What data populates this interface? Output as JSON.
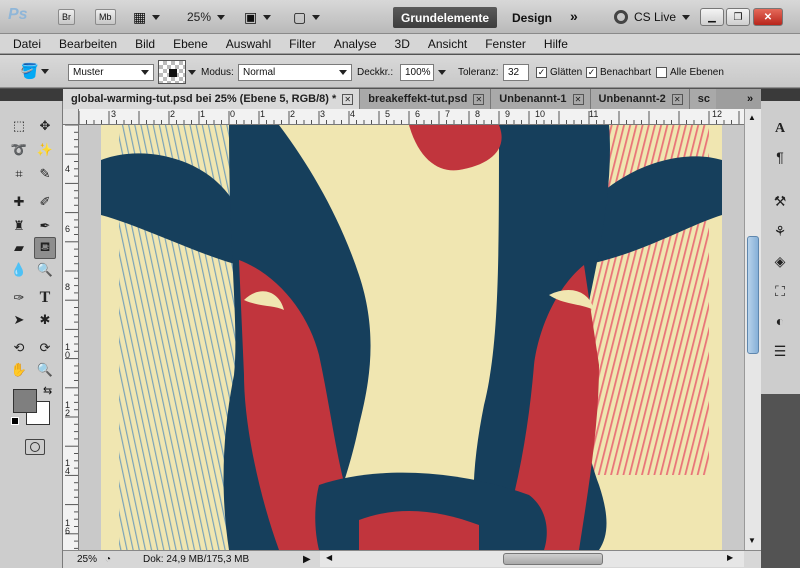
{
  "app_bar": {
    "logo": "Ps",
    "bridge_label": "Br",
    "minibridge_label": "Mb",
    "zoom": "25%",
    "workspace_active": "Grundelemente",
    "workspace_other": "Design",
    "more_glyph": "»",
    "cs_live": "CS Live"
  },
  "menu": [
    "Datei",
    "Bearbeiten",
    "Bild",
    "Ebene",
    "Auswahl",
    "Filter",
    "Analyse",
    "3D",
    "Ansicht",
    "Fenster",
    "Hilfe"
  ],
  "options": {
    "fill_source": "Muster",
    "mode_label": "Modus:",
    "mode_value": "Normal",
    "opacity_label": "Deckkr.:",
    "opacity_value": "100%",
    "tolerance_label": "Toleranz:",
    "tolerance_value": "32",
    "antialias_label": "Glätten",
    "contiguous_label": "Benachbart",
    "all_layers_label": "Alle Ebenen"
  },
  "tabs": [
    {
      "label": "global-warming-tut.psd bei 25% (Ebene 5, RGB/8) *"
    },
    {
      "label": "breakeffekt-tut.psd"
    },
    {
      "label": "Unbenannt-1"
    },
    {
      "label": "Unbenannt-2"
    },
    {
      "label": "sc"
    }
  ],
  "ruler_h": [
    "3",
    "2",
    "1",
    "0",
    "1",
    "2",
    "3",
    "4",
    "5",
    "6",
    "7",
    "8",
    "9",
    "10",
    "11",
    "12"
  ],
  "ruler_v": [
    "4",
    "6",
    "8",
    "1\n0",
    "1\n2",
    "1\n4",
    "1\n6"
  ],
  "status": {
    "zoom": "25%",
    "doc": "Dok: 24,9 MB/175,3 MB"
  },
  "colors": {
    "navy": "#163f5c",
    "red": "#c1353d",
    "cream": "#f0e6b1",
    "line_blue": "#7aa3b8",
    "line_red": "#e97478"
  }
}
